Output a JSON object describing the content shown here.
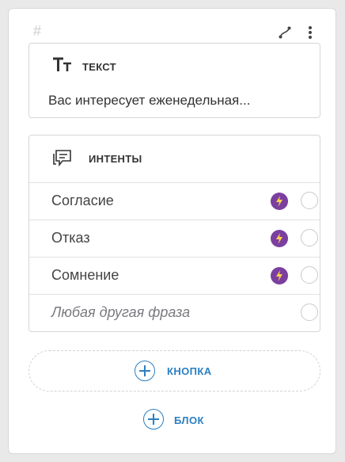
{
  "header": {
    "hash_symbol": "#"
  },
  "text_block": {
    "title": "ТЕКСТ",
    "preview": "Вас интересует еженедельная..."
  },
  "intents_block": {
    "title": "ИНТЕНТЫ",
    "items": [
      {
        "label": "Согласие",
        "has_action": true
      },
      {
        "label": "Отказ",
        "has_action": true
      },
      {
        "label": "Сомнение",
        "has_action": true
      },
      {
        "label": "Любая другая фраза",
        "has_action": false
      }
    ]
  },
  "add_button": {
    "label": "КНОПКА"
  },
  "add_block": {
    "label": "БЛОК"
  },
  "colors": {
    "accent": "#2b7fc2",
    "action_badge": "#7b3fa0",
    "bolt": "#ffd24a"
  }
}
